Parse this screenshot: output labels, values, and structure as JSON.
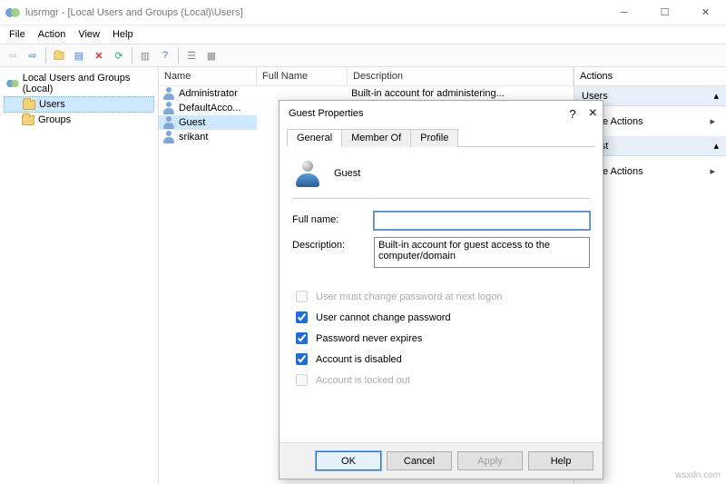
{
  "window": {
    "title": "lusrmgr - [Local Users and Groups (Local)\\Users]"
  },
  "menubar": [
    "File",
    "Action",
    "View",
    "Help"
  ],
  "tree": {
    "root": "Local Users and Groups (Local)",
    "children": [
      {
        "label": "Users",
        "selected": true
      },
      {
        "label": "Groups",
        "selected": false
      }
    ]
  },
  "list": {
    "columns": {
      "name": "Name",
      "fullname": "Full Name",
      "description": "Description"
    },
    "rows": [
      {
        "name": "Administrator",
        "fullname": "",
        "description": "Built-in account for administering..."
      },
      {
        "name": "DefaultAcco...",
        "fullname": "",
        "description": ""
      },
      {
        "name": "Guest",
        "fullname": "",
        "description": "",
        "selected": true
      },
      {
        "name": "srikant",
        "fullname": "",
        "description": ""
      }
    ]
  },
  "actions": {
    "title": "Actions",
    "sections": [
      {
        "header": "Users",
        "items": [
          "More Actions"
        ]
      },
      {
        "header": "Guest",
        "items": [
          "More Actions"
        ]
      }
    ],
    "more_label": "More Actions"
  },
  "dialog": {
    "title": "Guest Properties",
    "help_glyph": "?",
    "close_glyph": "×",
    "tabs": [
      "General",
      "Member Of",
      "Profile"
    ],
    "active_tab": 0,
    "username": "Guest",
    "fields": {
      "fullname_label": "Full name:",
      "fullname_value": "",
      "description_label": "Description:",
      "description_value": "Built-in account for guest access to the computer/domain"
    },
    "checks": {
      "must_change": {
        "label": "User must change password at next logon",
        "checked": false,
        "enabled": false
      },
      "cannot_change": {
        "label": "User cannot change password",
        "checked": true,
        "enabled": true
      },
      "never_expires": {
        "label": "Password never expires",
        "checked": true,
        "enabled": true
      },
      "disabled": {
        "label": "Account is disabled",
        "checked": true,
        "enabled": true
      },
      "locked": {
        "label": "Account is locked out",
        "checked": false,
        "enabled": false
      }
    },
    "buttons": {
      "ok": "OK",
      "cancel": "Cancel",
      "apply": "Apply",
      "help": "Help"
    }
  },
  "watermark": "wsxdn.com"
}
